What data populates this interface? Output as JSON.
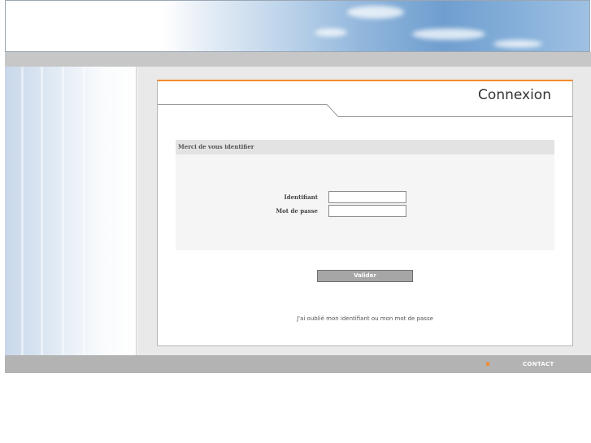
{
  "login": {
    "title": "Connexion",
    "box_header": "Merci de vous identifier",
    "username_label": "Identifiant",
    "username_value": "",
    "password_label": "Mot de passe",
    "password_value": "",
    "submit_label": "Valider",
    "forgot_link": "J'ai oublié mon identifiant ou mon mot de passe"
  },
  "footer": {
    "contact_label": "CONTACT"
  },
  "colors": {
    "accent": "#f28a2a",
    "panel_bg": "#e9e9e9",
    "bar_grey": "#b3b3b3",
    "button_grey": "#a6a6a6"
  }
}
